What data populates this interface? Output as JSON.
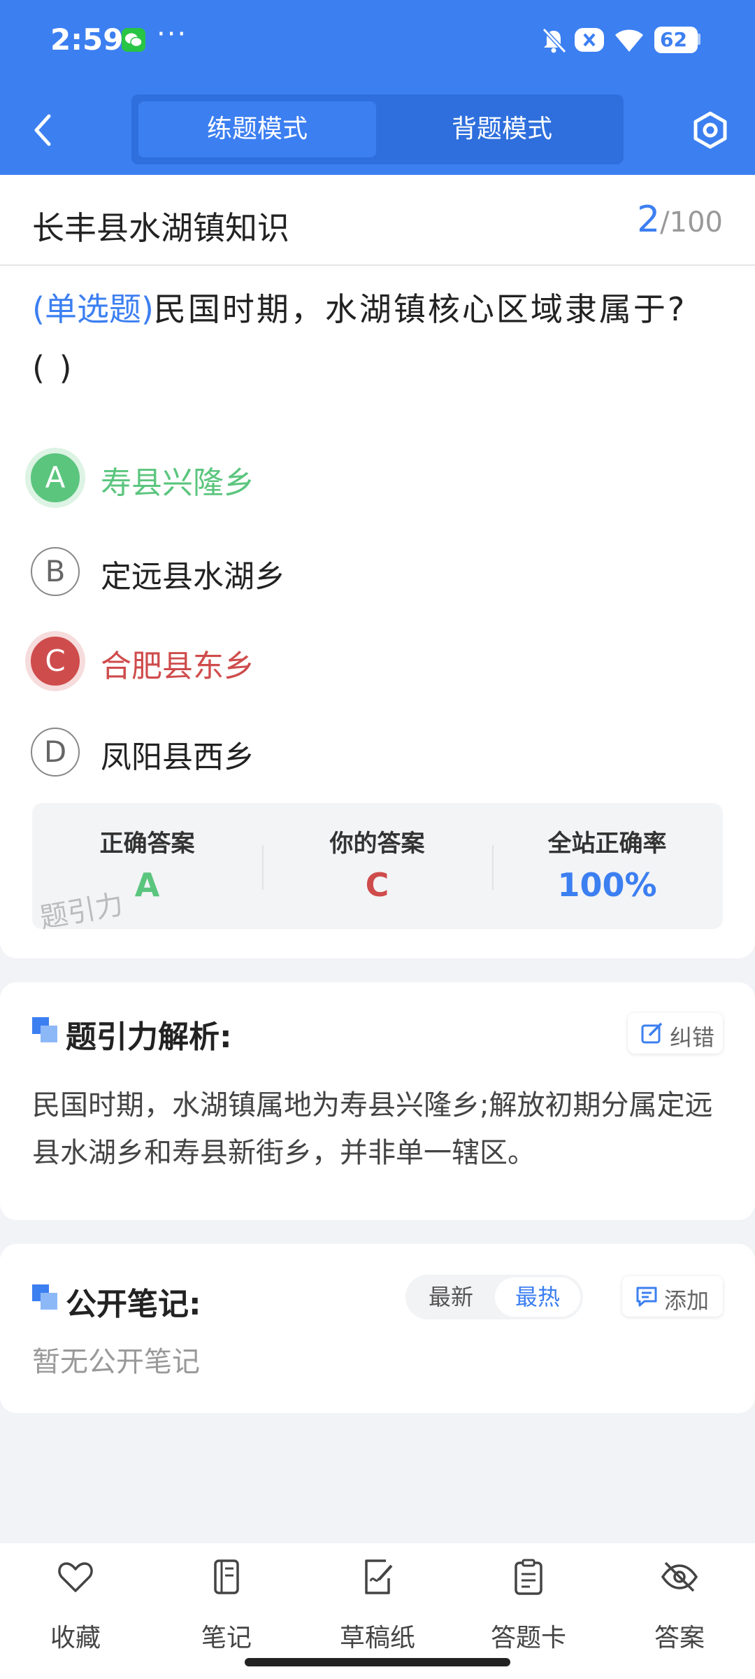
{
  "status_bar": {
    "time": "2:59",
    "more": "···",
    "battery": "62"
  },
  "header": {
    "modes": [
      {
        "label": "练题模式",
        "active": true
      },
      {
        "label": "背题模式",
        "active": false
      }
    ]
  },
  "question": {
    "set_title": "长丰县水湖镇知识",
    "current": "2",
    "separator": "/",
    "total": "100",
    "type": "(单选题)",
    "text": "民国时期，水湖镇核心区域隶属于?",
    "blank": "(        )",
    "options": [
      {
        "letter": "A",
        "text": "寿县兴隆乡",
        "state": "correct"
      },
      {
        "letter": "B",
        "text": "定远县水湖乡",
        "state": "normal"
      },
      {
        "letter": "C",
        "text": "合肥县东乡",
        "state": "wrong"
      },
      {
        "letter": "D",
        "text": "凤阳县西乡",
        "state": "normal"
      }
    ]
  },
  "answer_summary": {
    "correct_label": "正确答案",
    "correct_value": "A",
    "yours_label": "你的答案",
    "yours_value": "C",
    "rate_label": "全站正确率",
    "rate_value": "100%",
    "watermark": "题引力"
  },
  "analysis": {
    "title": "题引力解析:",
    "report_label": "纠错",
    "text": "民国时期，水湖镇属地为寿县兴隆乡;解放初期分属定远县水湖乡和寿县新街乡，并非单一辖区。"
  },
  "notes": {
    "title": "公开笔记:",
    "sort_new": "最新",
    "sort_hot": "最热",
    "add_label": "添加",
    "empty_text": "暂无公开笔记"
  },
  "bottom_nav": [
    {
      "label": "收藏",
      "icon": "heart-icon"
    },
    {
      "label": "笔记",
      "icon": "notebook-icon"
    },
    {
      "label": "草稿纸",
      "icon": "draft-paper-icon"
    },
    {
      "label": "答题卡",
      "icon": "answer-card-icon"
    },
    {
      "label": "答案",
      "icon": "eye-off-icon"
    }
  ],
  "colors": {
    "accent": "#3c7ff1",
    "correct": "#5bc57e",
    "wrong": "#cf4c4c"
  }
}
